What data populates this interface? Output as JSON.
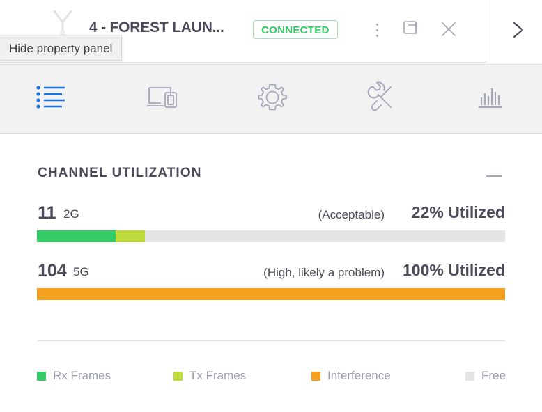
{
  "header": {
    "device_title": "4 - FOREST LAUN...",
    "status_label": "CONNECTED",
    "status_color": "#2ecc63",
    "ap_icon": "access-point-antenna-icon",
    "kebab_icon": "more-options-icon",
    "popout_icon": "pop-out-window-icon",
    "close_icon": "close-icon",
    "chevron_icon": "chevron-right-icon"
  },
  "tooltip": {
    "text": "Hide property panel"
  },
  "toolbar": {
    "tabs": [
      {
        "label": "",
        "icon": "bulleted-list-icon",
        "active": true
      },
      {
        "label": "",
        "icon": "devices-icon",
        "active": false
      },
      {
        "label": "",
        "icon": "gear-icon",
        "active": false
      },
      {
        "label": "",
        "icon": "tools-icon",
        "active": false
      },
      {
        "label": "",
        "icon": "bar-chart-icon",
        "active": false
      }
    ],
    "active_color": "#1673e6",
    "inactive_color": "#a5a8b8"
  },
  "panel": {
    "section_title": "CHANNEL UTILIZATION",
    "collapse_icon": "minus-collapse-icon",
    "channels": [
      {
        "channel": "11",
        "band": "2G",
        "status": "(Acceptable)",
        "utilization": "22% Utilized",
        "segments": [
          {
            "name": "Rx Frames",
            "percent": 16.8,
            "color": "#33cc66"
          },
          {
            "name": "Tx Frames",
            "percent": 6.2,
            "color": "#bedd3c"
          }
        ]
      },
      {
        "channel": "104",
        "band": "5G",
        "status": "(High, likely a problem)",
        "utilization": "100% Utilized",
        "segments": [
          {
            "name": "Interference",
            "percent": 100,
            "color": "#f2a01e"
          }
        ]
      }
    ],
    "legend": [
      {
        "label": "Rx Frames",
        "color": "#33cc66"
      },
      {
        "label": "Tx Frames",
        "color": "#bedd3c"
      },
      {
        "label": "Interference",
        "color": "#f2a01e"
      },
      {
        "label": "Free",
        "color": "#e4e4e6"
      }
    ]
  },
  "chart_data": {
    "type": "bar",
    "title": "CHANNEL UTILIZATION",
    "orientation": "horizontal-stacked",
    "categories": [
      "11 2G",
      "104 5G"
    ],
    "series": [
      {
        "name": "Rx Frames",
        "values": [
          16.8,
          0
        ],
        "color": "#33cc66"
      },
      {
        "name": "Tx Frames",
        "values": [
          6.2,
          0
        ],
        "color": "#bedd3c"
      },
      {
        "name": "Interference",
        "values": [
          0,
          100
        ],
        "color": "#f2a01e"
      },
      {
        "name": "Free",
        "values": [
          77,
          0
        ],
        "color": "#e4e4e6"
      }
    ],
    "totals": [
      22,
      100
    ],
    "total_labels": [
      "22% Utilized",
      "100% Utilized"
    ],
    "status_labels": [
      "(Acceptable)",
      "(High, likely a problem)"
    ],
    "xlabel": "",
    "ylabel": "",
    "xlim": [
      0,
      100
    ],
    "grid": false,
    "legend_position": "bottom"
  }
}
